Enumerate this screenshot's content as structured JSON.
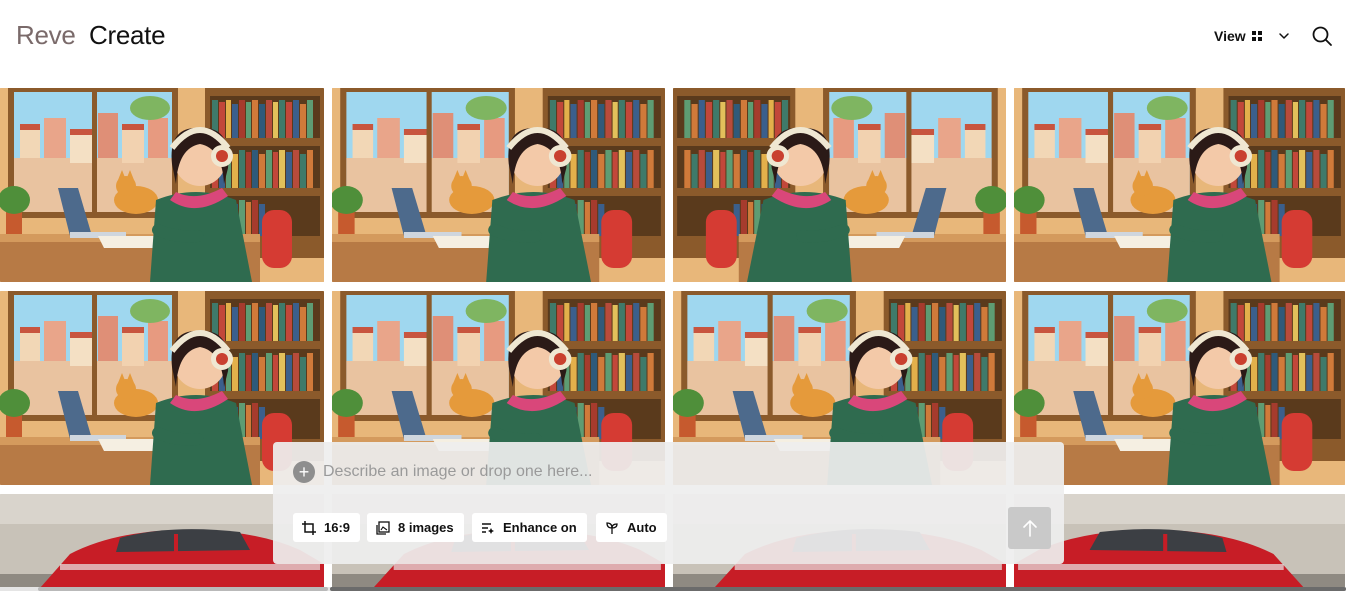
{
  "header": {
    "brand": "Reve",
    "title": "Create",
    "view_label": "View"
  },
  "icons": {
    "view_grid": "grid-icon",
    "view_dropdown": "chevron-down-icon",
    "search": "search-icon",
    "add": "plus-icon",
    "aspect": "crop-icon",
    "count": "images-icon",
    "enhance": "enhance-icon",
    "model": "sprout-icon",
    "send": "arrow-up-icon"
  },
  "gallery": {
    "rows": [
      {
        "subject": "lofi-girl-study",
        "tiles": 4
      },
      {
        "subject": "lofi-girl-study",
        "tiles": 4
      },
      {
        "subject": "red-car",
        "tiles": 4
      }
    ]
  },
  "composer": {
    "placeholder": "Describe an image or drop one here...",
    "aspect_label": "16:9",
    "count_label": "8 images",
    "enhance_label": "Enhance on",
    "model_label": "Auto"
  },
  "colors": {
    "brand": "#7a6a6a",
    "composer_bg": "#eeeeee",
    "send_disabled": "#c9c9c9"
  }
}
